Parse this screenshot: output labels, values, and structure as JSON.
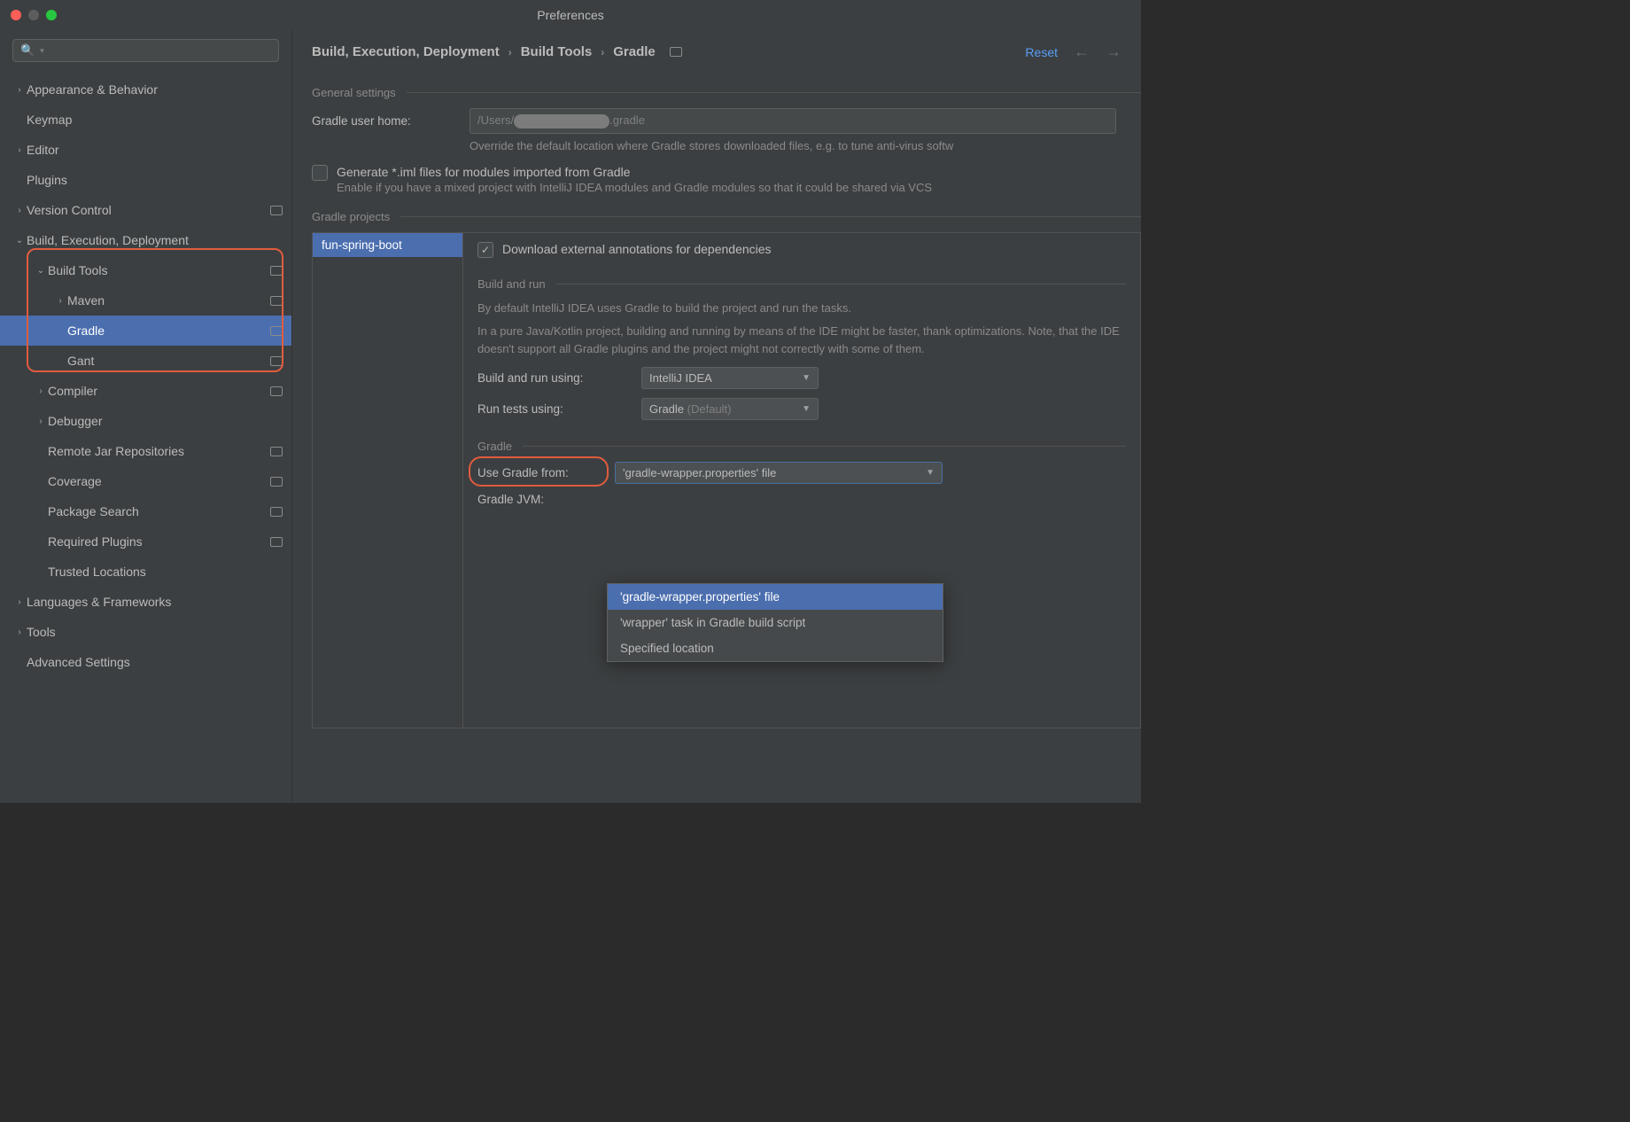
{
  "window": {
    "title": "Preferences"
  },
  "search": {
    "placeholder": ""
  },
  "sidebar": {
    "items": [
      {
        "label": "Appearance & Behavior",
        "chevron": "right",
        "indent": 0
      },
      {
        "label": "Keymap",
        "chevron": "",
        "indent": 0
      },
      {
        "label": "Editor",
        "chevron": "right",
        "indent": 0
      },
      {
        "label": "Plugins",
        "chevron": "",
        "indent": 0
      },
      {
        "label": "Version Control",
        "chevron": "right",
        "indent": 0,
        "scope": true
      },
      {
        "label": "Build, Execution, Deployment",
        "chevron": "down",
        "indent": 0
      },
      {
        "label": "Build Tools",
        "chevron": "down",
        "indent": 1,
        "scope": true
      },
      {
        "label": "Maven",
        "chevron": "right",
        "indent": 2,
        "scope": true
      },
      {
        "label": "Gradle",
        "chevron": "",
        "indent": 2,
        "scope": true,
        "selected": true
      },
      {
        "label": "Gant",
        "chevron": "",
        "indent": 2,
        "scope": true
      },
      {
        "label": "Compiler",
        "chevron": "right",
        "indent": 1,
        "scope": true
      },
      {
        "label": "Debugger",
        "chevron": "right",
        "indent": 1
      },
      {
        "label": "Remote Jar Repositories",
        "chevron": "",
        "indent": 1,
        "scope": true
      },
      {
        "label": "Coverage",
        "chevron": "",
        "indent": 1,
        "scope": true
      },
      {
        "label": "Package Search",
        "chevron": "",
        "indent": 1,
        "scope": true
      },
      {
        "label": "Required Plugins",
        "chevron": "",
        "indent": 1,
        "scope": true
      },
      {
        "label": "Trusted Locations",
        "chevron": "",
        "indent": 1
      },
      {
        "label": "Languages & Frameworks",
        "chevron": "right",
        "indent": 0
      },
      {
        "label": "Tools",
        "chevron": "right",
        "indent": 0
      },
      {
        "label": "Advanced Settings",
        "chevron": "",
        "indent": 0
      }
    ]
  },
  "breadcrumb": {
    "a": "Build, Execution, Deployment",
    "b": "Build Tools",
    "c": "Gradle"
  },
  "header": {
    "reset": "Reset"
  },
  "general": {
    "title": "General settings",
    "user_home_label": "Gradle user home:",
    "user_home_prefix": "/Users/",
    "user_home_suffix": ".gradle",
    "user_home_hint": "Override the default location where Gradle stores downloaded files, e.g. to tune anti-virus softw",
    "generate_iml_label": "Generate *.iml files for modules imported from Gradle",
    "generate_iml_hint": "Enable if you have a mixed project with IntelliJ IDEA modules and Gradle modules so that it could be shared via VCS"
  },
  "projects": {
    "title": "Gradle projects",
    "list": [
      "fun-spring-boot"
    ],
    "download_annotations": "Download external annotations for dependencies",
    "build_run_title": "Build and run",
    "build_run_para1": "By default IntelliJ IDEA uses Gradle to build the project and run the tasks.",
    "build_run_para2": "In a pure Java/Kotlin project, building and running by means of the IDE might be faster, thank optimizations. Note, that the IDE doesn't support all Gradle plugins and the project might not correctly with some of them.",
    "build_run_using_label": "Build and run using:",
    "build_run_using_value": "IntelliJ IDEA",
    "run_tests_label": "Run tests using:",
    "run_tests_value": "Gradle",
    "run_tests_suffix": "(Default)",
    "gradle_title": "Gradle",
    "use_gradle_from_label": "Use Gradle from:",
    "use_gradle_from_value": "'gradle-wrapper.properties' file",
    "gradle_jvm_label": "Gradle JVM:",
    "dropdown_options": [
      "'gradle-wrapper.properties' file",
      "'wrapper' task in Gradle build script",
      "Specified location"
    ]
  }
}
